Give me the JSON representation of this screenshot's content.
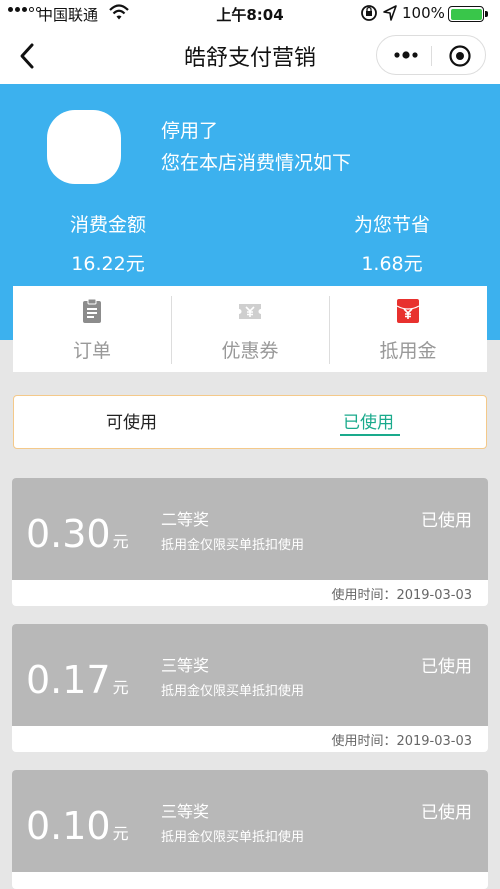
{
  "status_bar": {
    "carrier": "中国联通",
    "time": "上午8:04",
    "battery_percent": "100%",
    "battery_level": 1.0
  },
  "nav": {
    "title": "皓舒支付营销"
  },
  "hero": {
    "name": "停用了",
    "subtitle": "您在本店消费情况如下",
    "spent_label": "消费金额",
    "spent_value": "16.22元",
    "saved_label": "为您节省",
    "saved_value": "1.68元"
  },
  "menu": {
    "items": [
      {
        "label": "订单",
        "icon": "clipboard-icon"
      },
      {
        "label": "优惠券",
        "icon": "ticket-icon"
      },
      {
        "label": "抵用金",
        "icon": "red-envelope-icon"
      }
    ]
  },
  "tabs": {
    "available": "可使用",
    "used": "已使用",
    "active": "used"
  },
  "coupons": [
    {
      "amount": "0.30",
      "unit": "元",
      "prize": "二等奖",
      "desc": "抵用金仅限买单抵扣使用",
      "state": "已使用",
      "time": "使用时间：2019-03-03"
    },
    {
      "amount": "0.17",
      "unit": "元",
      "prize": "三等奖",
      "desc": "抵用金仅限买单抵扣使用",
      "state": "已使用",
      "time": "使用时间：2019-03-03"
    },
    {
      "amount": "0.10",
      "unit": "元",
      "prize": "三等奖",
      "desc": "抵用金仅限买单抵扣使用",
      "state": "已使用"
    }
  ],
  "colors": {
    "accent_blue": "#3cb1ee",
    "active_tab": "#1aaa8c",
    "coupon_used_gray": "#b8b8b8",
    "envelope_red": "#e8312e",
    "battery_green": "#39c64a"
  }
}
